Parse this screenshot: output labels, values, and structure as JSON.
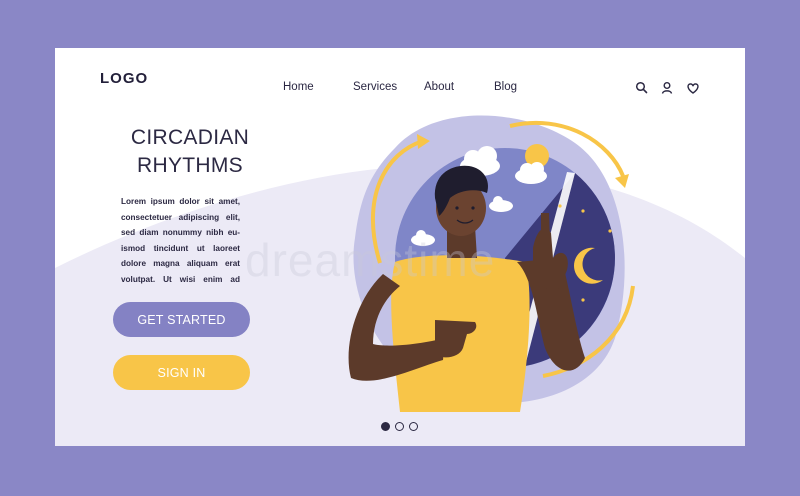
{
  "header": {
    "logo": "LOGO",
    "nav": [
      {
        "label": "Home"
      },
      {
        "label": "Services"
      },
      {
        "label": "About"
      },
      {
        "label": "Blog"
      }
    ],
    "icons": [
      "search-icon",
      "user-icon",
      "heart-icon"
    ]
  },
  "hero": {
    "title_line1": "CIRCADIAN",
    "title_line2": "RHYTHMS",
    "body": "Lorem ipsum dolor sit amet, consectetuer adipiscing elit, sed diam nonummy nibh eu-ismod tincidunt ut laoreet dolore magna aliquam erat volutpat. Ut wisi enim ad",
    "get_started": "GET STARTED",
    "sign_in": "SIGN IN"
  },
  "carousel": {
    "pages": 3,
    "active": 1
  },
  "colors": {
    "frame": "#8a87c6",
    "accent_purple": "#8482c4",
    "accent_yellow": "#f8c548",
    "night": "#3b3a7a",
    "day": "#7f86c8",
    "text": "#2c2943"
  }
}
